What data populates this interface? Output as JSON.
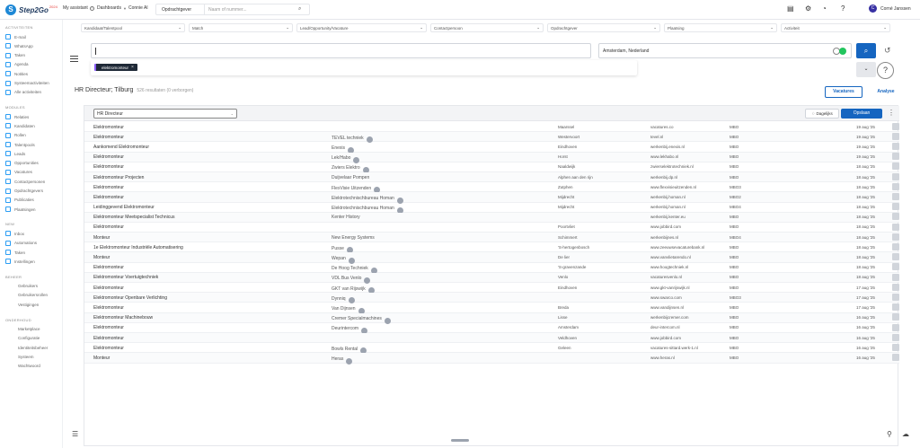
{
  "topbar": {
    "logo": "Step2Go",
    "logo_sup": "2024",
    "nav": [
      {
        "label": "My assistant"
      },
      {
        "label": "Dashboards"
      },
      {
        "label": "Connie AI"
      }
    ],
    "search_scope": "Opdrachtgever",
    "search_placeholder": "Naam of nummer...",
    "user_initial": "C",
    "user_name": "Corné Janssen"
  },
  "sidebar": {
    "sections": [
      {
        "title": "ACTIVITEITEN",
        "items": [
          "E-mail",
          "WhatsApp",
          "Taken",
          "Agenda",
          "Notities",
          "Systeemactiviteiten",
          "Alle activiteiten"
        ]
      },
      {
        "title": "MODULES",
        "items": [
          "Relaties",
          "Kandidaten",
          "Rollen",
          "Talentpools",
          "Leads",
          "Opportunities",
          "Vacatures",
          "Contactpersonen",
          "Opdrachtgevers",
          "Publicaties",
          "Plaatsingen"
        ]
      },
      {
        "title": "NEW",
        "items": [
          "Inbox",
          "Automations",
          "Taken",
          "Instellingen"
        ]
      },
      {
        "title": "BEHEER",
        "items": [
          "Gebruikers",
          "Gebruikersrollen",
          "Vestigingen"
        ]
      },
      {
        "title": "ONDERHOUD",
        "items": [
          "Marketplace",
          "Configuratie",
          "Identiteitsbeheer",
          "Systeem",
          "Wachtwoord"
        ]
      }
    ]
  },
  "filters": [
    "Kandidaat/Talentpool",
    "Match",
    "Lead/Opportunity/Vacature",
    "Contactpersoon",
    "Opdrachtgever",
    "Plaatsing",
    "Activiteit"
  ],
  "query": {
    "value": "",
    "chip": "elektromonteur"
  },
  "location": {
    "value": "Amsterdam, Nederland"
  },
  "results": {
    "title": "HR Directeur; Tilburg",
    "count": "526 resultaten (0 verborgen)",
    "tab_vacatures": "Vacatures",
    "tab_analyse": "Analyse"
  },
  "panel": {
    "profile": "HR Directeur",
    "daily": "Dagelijks",
    "save": "Opslaan"
  },
  "rows": [
    {
      "title": "Elektromonteur",
      "company": "",
      "badge": false,
      "city": "Maarssel",
      "site": "vacatures.co",
      "level": "MBO",
      "date": "19 aug '25"
    },
    {
      "title": "Elektromonteur",
      "company": "TEVEL techniek",
      "badge": true,
      "city": "Westervoort",
      "site": "tevel.nl",
      "level": "MBO",
      "date": "19 aug '25"
    },
    {
      "title": "Aankomend Elektromonteur",
      "company": "Enexis",
      "badge": true,
      "city": "Eindhoven",
      "site": "werkenbij.enexis.nl",
      "level": "MBO",
      "date": "19 aug '25"
    },
    {
      "title": "Elektromonteur",
      "company": "Lek/Habo",
      "badge": true,
      "city": "Horst",
      "site": "www.lekhabo.nl",
      "level": "MBO",
      "date": "19 aug '25"
    },
    {
      "title": "Elektromonteur",
      "company": "Zwiers Elektro",
      "badge": true,
      "city": "Naaldwijk",
      "site": "zwierselektrotechniek.nl",
      "level": "MBO",
      "date": "18 aug '25"
    },
    {
      "title": "Elektromonteur Projecten",
      "company": "Duijvelaar Pompen",
      "badge": false,
      "city": "Alphen aan den rijn",
      "site": "werkenbij.dp.nl",
      "level": "MBO",
      "date": "18 aug '25"
    },
    {
      "title": "Elektromonteur",
      "company": "FlexVisie Uitzenden",
      "badge": true,
      "city": "Zutphen",
      "site": "www.flexvisieuitzenden.nl",
      "level": "MBO3",
      "date": "18 aug '25"
    },
    {
      "title": "Elektromonteur",
      "company": "Elektrotechnischbureau Homan",
      "badge": true,
      "city": "Mijdrecht",
      "site": "werkenbij.homan.nl",
      "level": "MBO2",
      "date": "18 aug '25"
    },
    {
      "title": "Leidinggevend Elektromonteur",
      "company": "Elektrotechnischbureau Homan",
      "badge": true,
      "city": "Mijdrecht",
      "site": "werkenbij.homan.nl",
      "level": "MBO4",
      "date": "18 aug '25"
    },
    {
      "title": "Elektromonteur Meetspecialist Technicus",
      "company": "Kenter History",
      "badge": false,
      "city": "",
      "site": "werkenbij.kenter.eu",
      "level": "MBO",
      "date": "18 aug '25"
    },
    {
      "title": "Elektromonteur",
      "company": "",
      "badge": false,
      "city": "Poortvliet",
      "site": "www.jobbird.com",
      "level": "MBO",
      "date": "18 aug '25"
    },
    {
      "title": "Monteur",
      "company": "New Energy Systems",
      "badge": false,
      "city": "Schimmert",
      "site": "werkenbijnes.nl",
      "level": "MBO4",
      "date": "18 aug '25"
    },
    {
      "title": "1e Elektromonteur Industriële Automatisering",
      "company": "Pusse",
      "badge": true,
      "city": "'S-hertogenbosch",
      "site": "www.zeeuwsevacaturebank.nl",
      "level": "MBO",
      "date": "18 aug '25"
    },
    {
      "title": "Monteur",
      "company": "Wepan",
      "badge": true,
      "city": "De lier",
      "site": "www.vanvlietarendo.nl",
      "level": "MBO",
      "date": "18 aug '25"
    },
    {
      "title": "Elektromonteur",
      "company": "De Hoog Techniek",
      "badge": true,
      "city": "'S-gravenzande",
      "site": "www.hoogtechniek.nl",
      "level": "MBO",
      "date": "18 aug '25"
    },
    {
      "title": "Elektromonteur Voertuigtechniek",
      "company": "VDL Bus Venlo",
      "badge": true,
      "city": "Venlo",
      "site": "vacaturesvenlo.nl",
      "level": "MBO",
      "date": "18 aug '25"
    },
    {
      "title": "Elektromonteur",
      "company": "GKT van Rijswijk",
      "badge": true,
      "city": "Eindhoven",
      "site": "www.gkt-vanrijswijk.nl",
      "level": "MBO",
      "date": "17 aug '25"
    },
    {
      "title": "Elektromonteur Openbare Verlichting",
      "company": "Dynniq",
      "badge": true,
      "city": "",
      "site": "www.swarco.com",
      "level": "MBO3",
      "date": "17 aug '25"
    },
    {
      "title": "Elektromonteur",
      "company": "Van Dijnsen",
      "badge": true,
      "city": "Breda",
      "site": "www.vandijnsen.nl",
      "level": "MBO",
      "date": "17 aug '25"
    },
    {
      "title": "Elektromonteur Machinebouw",
      "company": "Cremer Specialmachines",
      "badge": true,
      "city": "Lisse",
      "site": "werkenbijcremer.com",
      "level": "MBO",
      "date": "16 aug '25"
    },
    {
      "title": "Elektromonteur",
      "company": "Deurintercom",
      "badge": true,
      "city": "Amsterdam",
      "site": "deur-intercom.nl",
      "level": "MBO",
      "date": "16 aug '25"
    },
    {
      "title": "Elektromonteur",
      "company": "",
      "badge": false,
      "city": "Veldhoven",
      "site": "www.jobbird.com",
      "level": "MBO",
      "date": "16 aug '25"
    },
    {
      "title": "Elektromonteur",
      "company": "Bowls Rental",
      "badge": true,
      "city": "Geleen",
      "site": "vacatures-sittard.werk-1.nl",
      "level": "MBO",
      "date": "16 aug '25"
    },
    {
      "title": "Monteur",
      "company": "Heras",
      "badge": true,
      "city": "",
      "site": "www.heras.nl",
      "level": "MBO",
      "date": "16 aug '25"
    }
  ]
}
